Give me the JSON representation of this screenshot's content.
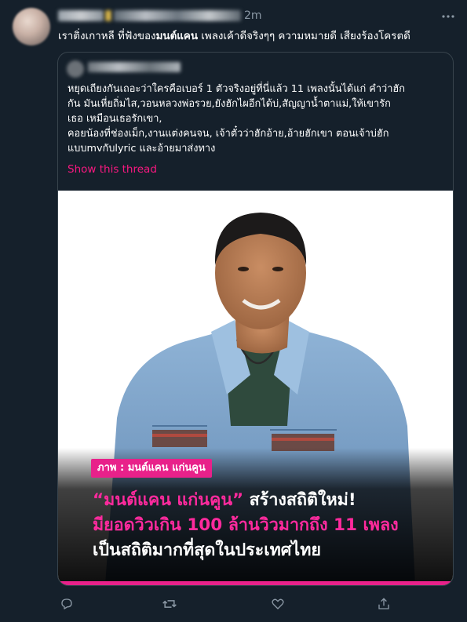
{
  "tweet": {
    "time": "2m",
    "text_parts": {
      "a": "เราติ่งเกาหลี ที่ฟังของ",
      "b": "มนต์แคน",
      "c": " เพลงเค้าดีจริงๆๆ ความหมายดี เสียงร้องโครตดี"
    }
  },
  "quote": {
    "lines": [
      "หยุดเถียงกันเถอะว่าใครคือเบอร์ 1 ตัวจริงอยู่ที่นี่แล้ว 11 เพลงนั้นได้แก่ คำว่าฮัก",
      "กัน มันเหี่ยถิ่มไส,วอนหลวงพ่อรวย,ยังฮักไผอีกได้บ่,สัญญาน้ำตาแม่,ให้เขารัก",
      "เธอ เหมือนเธอรักเขา,",
      "คอยน้องที่ช่องเม็ก,งานแต่งคนจน, เจ้าตั๋วว่าฮักอ้าย,อ้ายฮักเขา ตอนเจ้าบ่ฮัก",
      "แบบmvกับlyric และอ้ายมาส่งทาง"
    ],
    "show_thread": "Show this thread"
  },
  "image": {
    "credit": "ภาพ : มนต์แคน แก่นคูน",
    "headline": {
      "line1_name": "“มนต์แคน แก่นคูน”",
      "line1_rest": " สร้างสถิติใหม่!",
      "line2": "มียอดวิวเกิน 100 ล้านวิวมากถึง 11 เพลง",
      "line3": "เป็นสถิติมากที่สุดในประเทศไทย"
    }
  },
  "icons": {
    "more": "more-icon",
    "reply": "reply-icon",
    "retweet": "retweet-icon",
    "like": "like-icon",
    "share": "share-icon"
  },
  "colors": {
    "background": "#15202b",
    "accent_pink": "#e8218a",
    "muted": "#8b98a5",
    "border": "#38444d"
  }
}
